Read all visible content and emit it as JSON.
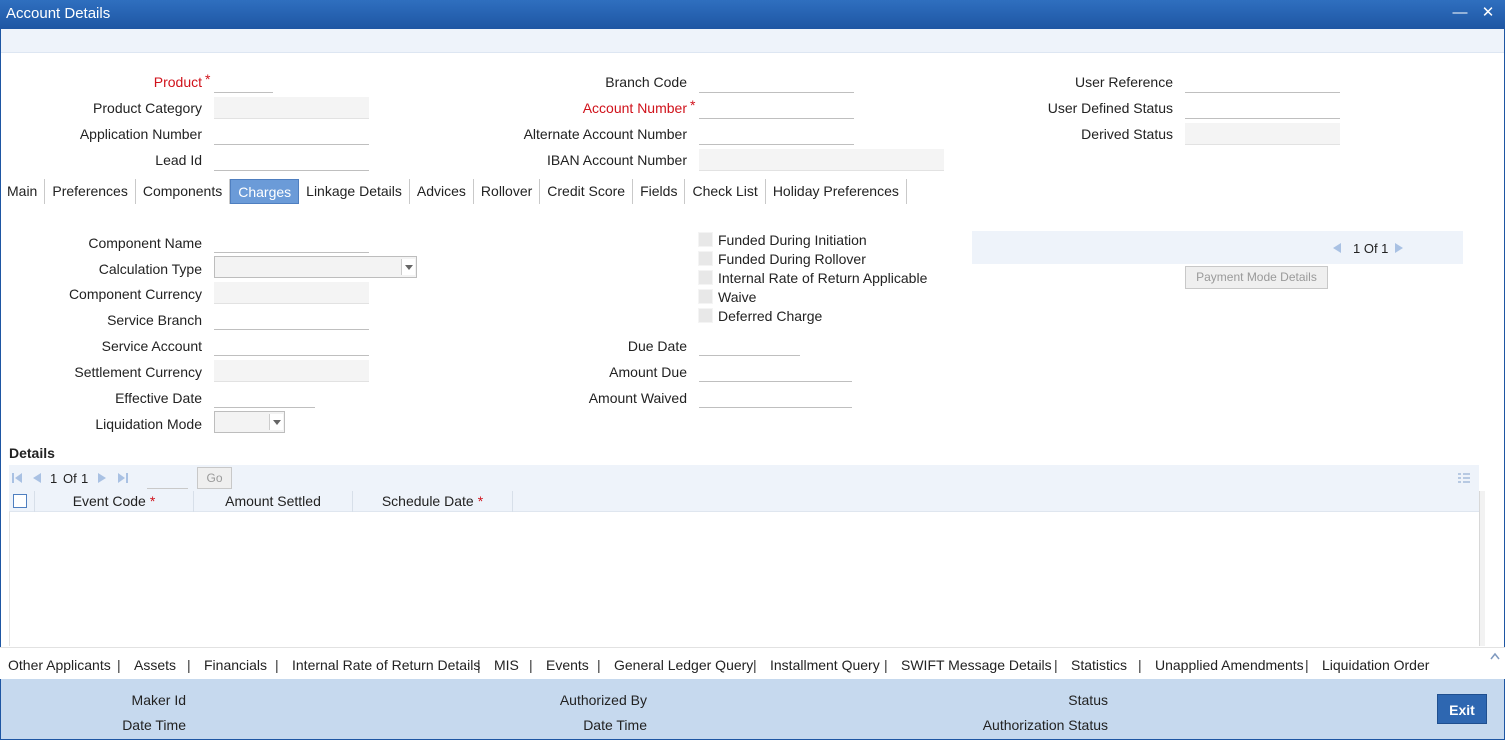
{
  "window": {
    "title": "Account Details"
  },
  "header": {
    "product_label": "Product",
    "product_category_label": "Product Category",
    "application_number_label": "Application Number",
    "lead_id_label": "Lead Id",
    "branch_code_label": "Branch Code",
    "account_number_label": "Account Number",
    "alternate_account_label": "Alternate Account Number",
    "iban_label": "IBAN Account Number",
    "user_reference_label": "User Reference",
    "user_defined_status_label": "User Defined Status",
    "derived_status_label": "Derived Status",
    "required_marker": "*"
  },
  "tabs": [
    {
      "label": "Main"
    },
    {
      "label": "Preferences"
    },
    {
      "label": "Components"
    },
    {
      "label": "Charges",
      "active": true
    },
    {
      "label": "Linkage Details"
    },
    {
      "label": "Advices"
    },
    {
      "label": "Rollover"
    },
    {
      "label": "Credit Score"
    },
    {
      "label": "Fields"
    },
    {
      "label": "Check List"
    },
    {
      "label": "Holiday Preferences"
    }
  ],
  "charges": {
    "component_name_label": "Component Name",
    "calculation_type_label": "Calculation Type",
    "component_currency_label": "Component Currency",
    "service_branch_label": "Service Branch",
    "service_account_label": "Service Account",
    "settlement_currency_label": "Settlement Currency",
    "effective_date_label": "Effective Date",
    "liquidation_mode_label": "Liquidation Mode",
    "funded_initiation_label": "Funded During Initiation",
    "funded_rollover_label": "Funded During Rollover",
    "irr_applicable_label": "Internal Rate of Return Applicable",
    "waive_label": "Waive",
    "deferred_charge_label": "Deferred Charge",
    "due_date_label": "Due Date",
    "amount_due_label": "Amount Due",
    "amount_waived_label": "Amount Waived",
    "pager_text": "1 Of 1",
    "payment_mode_button": "Payment Mode Details"
  },
  "details": {
    "title": "Details",
    "page_current": "1",
    "page_of": "Of",
    "page_total": "1",
    "go_label": "Go",
    "columns": [
      {
        "label": "Event Code",
        "required": true
      },
      {
        "label": "Amount Settled",
        "required": false
      },
      {
        "label": "Schedule Date",
        "required": true
      }
    ]
  },
  "bottom_links": [
    "Other Applicants",
    "Assets",
    "Financials",
    "Internal Rate of Return Details",
    "MIS",
    "Events",
    "General Ledger Query",
    "Installment Query",
    "SWIFT Message Details",
    "Statistics",
    "Unapplied Amendments",
    "Liquidation Order"
  ],
  "footer": {
    "maker_id": "Maker Id",
    "date_time_1": "Date Time",
    "authorized_by": "Authorized By",
    "date_time_2": "Date Time",
    "status": "Status",
    "authorization_status": "Authorization Status",
    "exit_label": "Exit"
  }
}
